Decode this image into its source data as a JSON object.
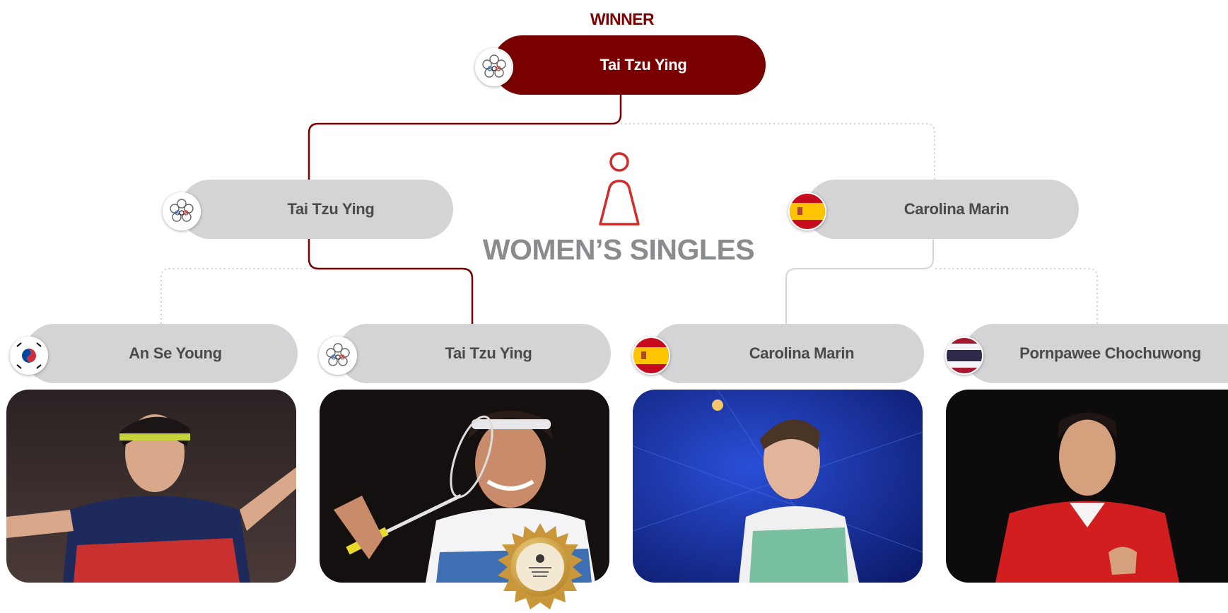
{
  "winner": {
    "label": "WINNER",
    "name": "Tai Tzu Ying",
    "flag_icon": "chinese-taipei-olympic-flag-icon"
  },
  "event": {
    "title": "WOMEN’S SINGLES",
    "icon": "female-figure-icon",
    "accent_color": "#d42a2a"
  },
  "semifinals": [
    {
      "name": "Tai Tzu Ying",
      "flag_icon": "chinese-taipei-olympic-flag-icon"
    },
    {
      "name": "Carolina Marin",
      "flag_icon": "spain-flag-icon"
    }
  ],
  "quarterfinals": [
    {
      "name": "An Se Young",
      "flag_icon": "south-korea-flag-icon"
    },
    {
      "name": "Tai Tzu Ying",
      "flag_icon": "chinese-taipei-olympic-flag-icon"
    },
    {
      "name": "Carolina Marin",
      "flag_icon": "spain-flag-icon"
    },
    {
      "name": "Pornpawee Chochuwong",
      "flag_icon": "thailand-flag-icon"
    }
  ],
  "colors": {
    "winner_path": "#7a0000",
    "pill_bg": "#d4d4d6",
    "title": "#8a8b8f"
  }
}
